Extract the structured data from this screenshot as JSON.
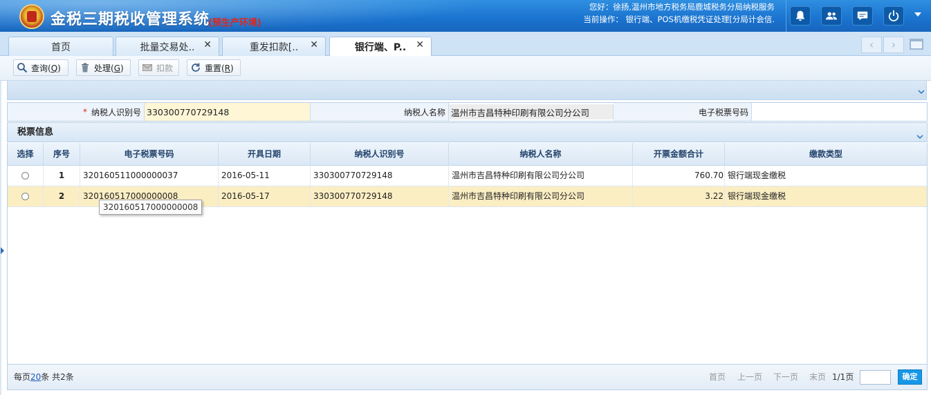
{
  "header": {
    "title": "金税三期税收管理系统",
    "env": "(预生产环境)",
    "user_line": "您好：徐扬,温州市地方税务局鹿城税务分局纳税服务",
    "operation_line": "当前操作： 银行端、POS机缴税凭证处理[分局计会信.",
    "icons": [
      "bell-icon",
      "users-icon",
      "chat-icon",
      "power-icon",
      "chevron-down-icon"
    ]
  },
  "tabs": [
    {
      "label": "首页",
      "closable": false
    },
    {
      "label": "批量交易处..",
      "closable": true
    },
    {
      "label": "重发扣款[..",
      "closable": true
    },
    {
      "label": "银行端、P..",
      "closable": true,
      "active": true
    }
  ],
  "toolbar": {
    "query": {
      "text": "查询(",
      "key": "Q",
      "end": ")"
    },
    "process": {
      "text": "处理(",
      "key": "G",
      "end": ")"
    },
    "deduct": {
      "text": "扣款"
    },
    "reset": {
      "text": "重置(",
      "key": "R",
      "end": ")"
    }
  },
  "query_form": {
    "taxpayer_id_label": "纳税人识别号",
    "taxpayer_id_value": "330300770729148",
    "taxpayer_name_label": "纳税人名称",
    "taxpayer_name_value": "温州市吉昌特种印刷有限公司分公司",
    "ticket_no_label": "电子税票号码",
    "ticket_no_value": "",
    "required_mark": "*"
  },
  "panel": {
    "title": "税票信息"
  },
  "table": {
    "columns": [
      "选择",
      "序号",
      "电子税票号码",
      "开具日期",
      "纳税人识别号",
      "纳税人名称",
      "开票金额合计",
      "缴款类型"
    ],
    "rows": [
      {
        "seq": "1",
        "ticket": "320160511000000037",
        "date": "2016-05-11",
        "tid": "330300770729148",
        "name": "温州市吉昌特种印刷有限公司分公司",
        "amount": "760.70",
        "type": "银行端现金缴税",
        "selected": false
      },
      {
        "seq": "2",
        "ticket": "320160517000000008",
        "date": "2016-05-17",
        "tid": "330300770729148",
        "name": "温州市吉昌特种印刷有限公司分公司",
        "amount": "3.22",
        "type": "银行端现金缴税",
        "selected": false,
        "highlighted": true
      }
    ],
    "tooltip": "320160517000000008"
  },
  "pager": {
    "per_page_prefix": "每页",
    "per_page": "20",
    "per_page_suffix": "条 共2条",
    "first": "首页",
    "prev": "上一页",
    "next": "下一页",
    "last": "末页",
    "page_info": "1/1页",
    "confirm": "确定"
  },
  "colors": {
    "header_blue": "#1a73cf",
    "highlight_row": "#fbeec3",
    "env_red": "#e0261a",
    "confirm_blue": "#1797e6"
  }
}
